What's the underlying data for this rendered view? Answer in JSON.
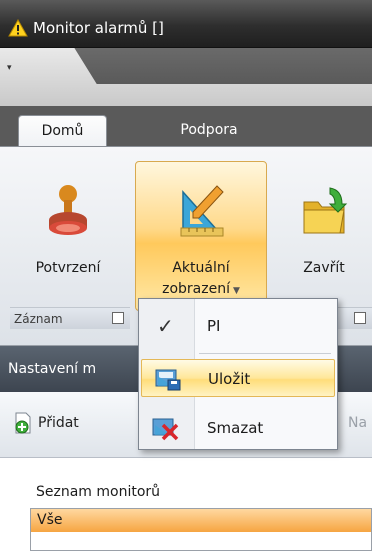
{
  "window": {
    "title": "Monitor alarmů []"
  },
  "tabs": [
    {
      "label": "Domů",
      "active": true
    },
    {
      "label": "Podpora",
      "active": false
    }
  ],
  "ribbon": {
    "buttons": [
      {
        "label": "Potvrzení",
        "icon": "stamp-icon"
      },
      {
        "label1": "Aktuální",
        "label2": "zobrazení",
        "icon": "triangle-ruler-pencil-icon",
        "has_dropdown": true
      },
      {
        "label": "Zavřít",
        "icon": "folder-arrow-icon"
      }
    ],
    "groups": [
      {
        "label": "Záznam"
      }
    ]
  },
  "dropdown_menu": {
    "items": [
      {
        "label": "PI",
        "checked": true
      },
      {
        "label": "Uložit",
        "icon": "save-view-icon",
        "highlighted": true
      },
      {
        "label": "Smazat",
        "icon": "delete-view-icon"
      }
    ]
  },
  "panel": {
    "header_visible": "Nastavení m",
    "toolbar": {
      "add_label": "Přidat",
      "partial_label": "Na"
    },
    "list_label": "Seznam monitorů",
    "list_items": [
      "Vše"
    ]
  },
  "colors": {
    "accent_hover": "#ffd98a",
    "selection": "#f6a542",
    "title_bar": "#2e2e2e"
  }
}
